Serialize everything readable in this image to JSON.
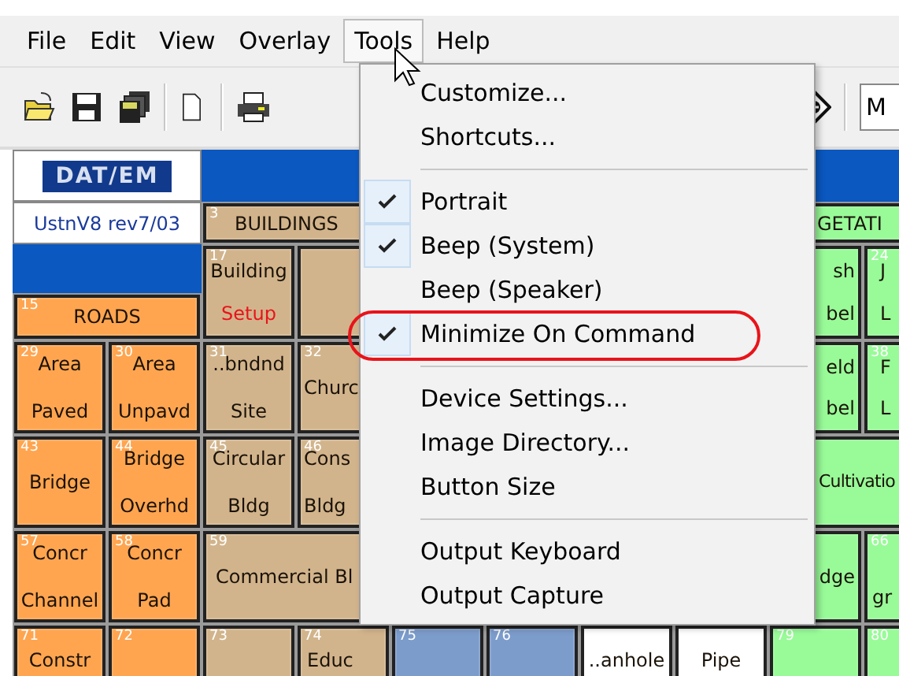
{
  "menubar": [
    {
      "label": "File",
      "selected": false
    },
    {
      "label": "Edit",
      "selected": false
    },
    {
      "label": "View",
      "selected": false
    },
    {
      "label": "Overlay",
      "selected": false
    },
    {
      "label": "Tools",
      "selected": true
    },
    {
      "label": "Help",
      "selected": false
    }
  ],
  "toolbar": {
    "field": {
      "value": "M"
    }
  },
  "panel": {
    "logo": "DAT/EM",
    "version": "UstnV8 rev7/03",
    "cells": [
      {
        "number": "3",
        "middle": "BUILDINGS",
        "color": "#d2b48c"
      },
      {
        "middle": "GETATI",
        "color": "#98fb98"
      },
      {
        "number": "15",
        "middle": "ROADS",
        "color": "#ffa550"
      },
      {
        "number": "17",
        "top": "Building",
        "note": "Setup",
        "color": "#d2b48c"
      },
      {
        "color": "#d2b48c"
      },
      {
        "top": "sh",
        "bottom": "bel",
        "color": "#98fb98"
      },
      {
        "number": "24",
        "top": "J",
        "bottom": "L",
        "color": "#98fb98"
      },
      {
        "number": "29",
        "top": "Area",
        "bottom": "Paved",
        "color": "#ffa550"
      },
      {
        "number": "30",
        "top": "Area",
        "bottom": "Unpavd",
        "color": "#ffa550"
      },
      {
        "number": "31",
        "top": "..bndnd",
        "bottom": "Site",
        "color": "#d2b48c"
      },
      {
        "number": "32",
        "middle": "Churc",
        "color": "#d2b48c"
      },
      {
        "top": "eld",
        "bottom": "bel",
        "color": "#98fb98"
      },
      {
        "number": "38",
        "top": "F",
        "bottom": "L",
        "color": "#98fb98"
      },
      {
        "number": "43",
        "middle": "Bridge",
        "color": "#ffa550"
      },
      {
        "number": "44",
        "top": "Bridge",
        "bottom": "Overhd",
        "color": "#ffa550"
      },
      {
        "number": "45",
        "top": "Circular",
        "bottom": "Bldg",
        "color": "#d2b48c"
      },
      {
        "number": "46",
        "top": "Cons",
        "bottom": "Bldg",
        "color": "#d2b48c"
      },
      {
        "middle": "Cultivatio",
        "color": "#98fb98"
      },
      {
        "number": "57",
        "top": "Concr",
        "bottom": "Channel",
        "color": "#ffa550"
      },
      {
        "number": "58",
        "top": "Concr",
        "bottom": "Pad",
        "color": "#ffa550"
      },
      {
        "number": "59",
        "middle": "Commercial Bl",
        "color": "#d2b48c"
      },
      {
        "middle": "dge",
        "color": "#98fb98"
      },
      {
        "number": "66",
        "bottom": "gr",
        "color": "#98fb98"
      },
      {
        "number": "71",
        "top": "Constr",
        "color": "#ffa550"
      },
      {
        "number": "72",
        "color": "#ffa550"
      },
      {
        "number": "73",
        "color": "#d2b48c"
      },
      {
        "number": "74",
        "top": "Educ",
        "color": "#d2b48c"
      },
      {
        "number": "75",
        "color": "#7c9ccc"
      },
      {
        "number": "76",
        "color": "#7c9ccc"
      },
      {
        "top": "..anhole",
        "color": "#ffffff"
      },
      {
        "top": "Pipe",
        "color": "#ffffff"
      },
      {
        "number": "79",
        "color": "#98fb98"
      },
      {
        "number": "80",
        "color": "#98fb98"
      }
    ]
  },
  "menu": {
    "items": [
      {
        "kind": "item",
        "label": "Customize...",
        "checked": false,
        "circled": false
      },
      {
        "kind": "item",
        "label": "Shortcuts...",
        "checked": false,
        "circled": false
      },
      {
        "kind": "separator"
      },
      {
        "kind": "item",
        "label": "Portrait",
        "checked": true,
        "circled": false
      },
      {
        "kind": "item",
        "label": "Beep (System)",
        "checked": true,
        "circled": false
      },
      {
        "kind": "item",
        "label": "Beep (Speaker)",
        "checked": false,
        "circled": false
      },
      {
        "kind": "item",
        "label": "Minimize On Command",
        "checked": true,
        "circled": true
      },
      {
        "kind": "separator"
      },
      {
        "kind": "item",
        "label": "Device Settings...",
        "checked": false,
        "circled": false
      },
      {
        "kind": "item",
        "label": "Image Directory...",
        "checked": false,
        "circled": false
      },
      {
        "kind": "item",
        "label": "Button Size",
        "checked": false,
        "circled": false
      },
      {
        "kind": "separator"
      },
      {
        "kind": "item",
        "label": "Output Keyboard",
        "checked": false,
        "circled": false
      },
      {
        "kind": "item",
        "label": "Output Capture",
        "checked": false,
        "circled": false
      }
    ]
  }
}
